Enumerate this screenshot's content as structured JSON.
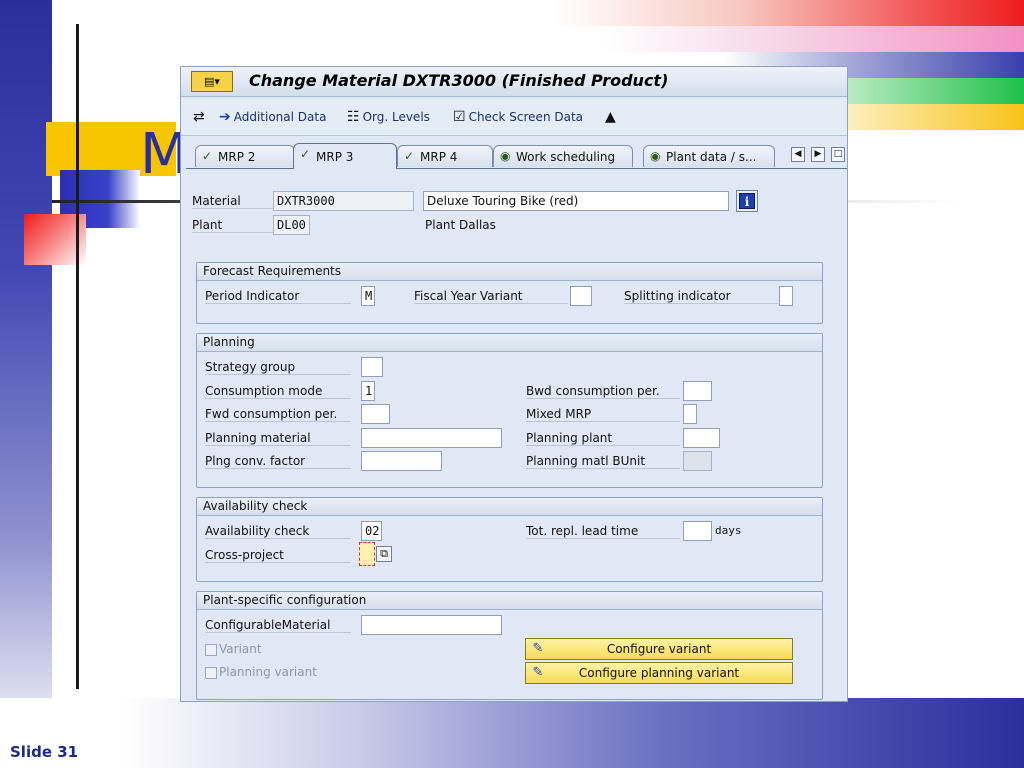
{
  "slide": {
    "title_fragment": "M",
    "number_label": "Slide 31"
  },
  "window": {
    "menu_icon": "menu-icon",
    "title": "Change Material DXTR3000 (Finished Product)"
  },
  "toolbar": {
    "additional_data": "Additional Data",
    "org_levels": "Org. Levels",
    "check_screen_data": "Check Screen Data"
  },
  "tabs": [
    {
      "label": "MRP 2",
      "active": false
    },
    {
      "label": "MRP 3",
      "active": true
    },
    {
      "label": "MRP 4",
      "active": false
    },
    {
      "label": "Work scheduling",
      "active": false
    },
    {
      "label": "Plant data / s...",
      "active": false
    }
  ],
  "header": {
    "material_label": "Material",
    "material_value": "DXTR3000",
    "material_desc": "Deluxe Touring Bike (red)",
    "plant_label": "Plant",
    "plant_value": "DL00",
    "plant_desc": "Plant Dallas"
  },
  "forecast": {
    "title": "Forecast Requirements",
    "period_indicator_label": "Period Indicator",
    "period_indicator_value": "M",
    "fiscal_year_label": "Fiscal Year Variant",
    "fiscal_year_value": "",
    "splitting_label": "Splitting indicator",
    "splitting_value": ""
  },
  "planning": {
    "title": "Planning",
    "strategy_group_label": "Strategy group",
    "strategy_group_value": "",
    "consumption_mode_label": "Consumption mode",
    "consumption_mode_value": "1",
    "bwd_label": "Bwd consumption per.",
    "bwd_value": "",
    "fwd_label": "Fwd consumption per.",
    "fwd_value": "",
    "mixed_mrp_label": "Mixed MRP",
    "mixed_mrp_value": "",
    "planning_material_label": "Planning material",
    "planning_material_value": "",
    "planning_plant_label": "Planning plant",
    "planning_plant_value": "",
    "conv_factor_label": "Plng conv. factor",
    "conv_factor_value": "",
    "matl_bunit_label": "Planning matl BUnit",
    "matl_bunit_value": ""
  },
  "availability": {
    "title": "Availability check",
    "check_label": "Availability check",
    "check_value": "02",
    "lead_time_label": "Tot. repl. lead time",
    "lead_time_value": "",
    "days_label": "days",
    "cross_project_label": "Cross-project"
  },
  "configuration": {
    "title": "Plant-specific configuration",
    "configurable_label": "ConfigurableMaterial",
    "configurable_value": "",
    "variant_label": "Variant",
    "planning_variant_label": "Planning variant",
    "configure_variant_button": "Configure variant",
    "configure_planning_variant_button": "Configure planning variant"
  }
}
